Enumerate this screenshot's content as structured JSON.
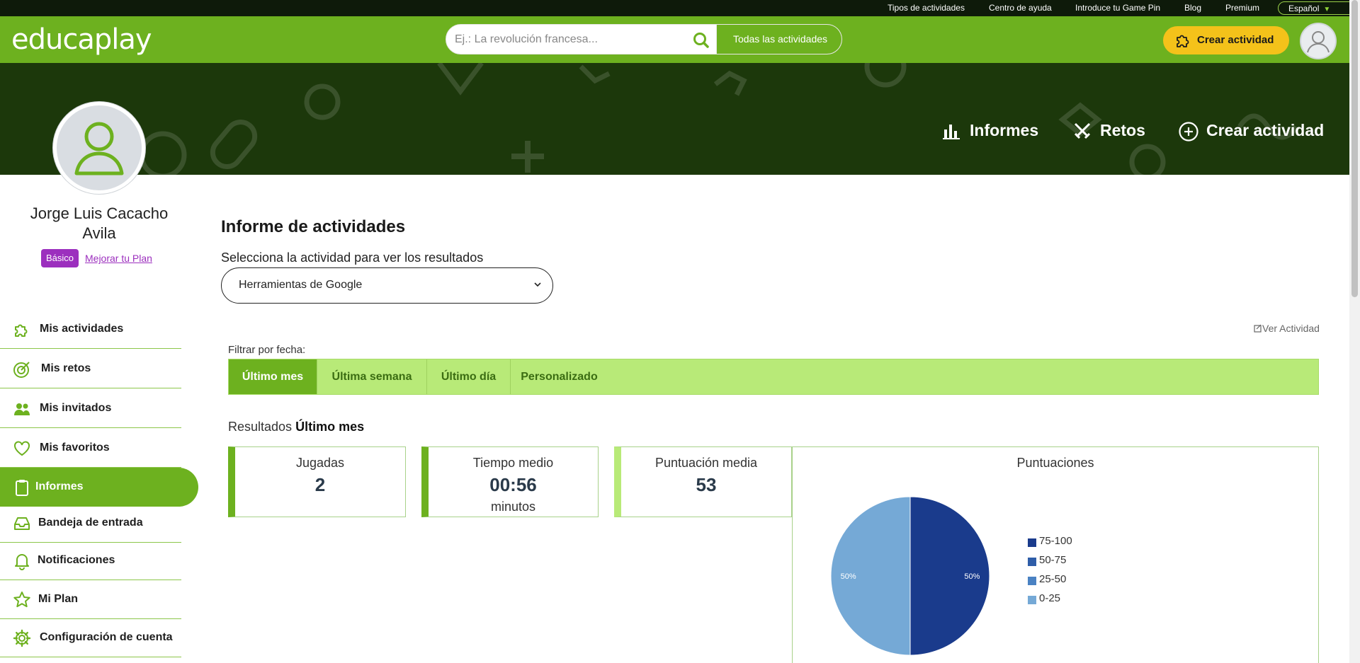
{
  "topbar": {
    "links": [
      "Tipos de actividades",
      "Centro de ayuda",
      "Introduce tu Game Pin",
      "Blog",
      "Premium"
    ],
    "language": "Español"
  },
  "header": {
    "logo": "educaplay",
    "search_placeholder": "Ej.: La revolución francesa...",
    "search_scope": "Todas las actividades",
    "create_label": "Crear actividad"
  },
  "banner_nav": {
    "reports": "Informes",
    "challenges": "Retos",
    "create": "Crear actividad"
  },
  "profile": {
    "name": "Jorge Luis Cacacho Avila",
    "plan": "Básico",
    "upgrade": "Mejorar tu Plan"
  },
  "sidebar": {
    "items": [
      {
        "label": "Mis actividades",
        "icon": "puzzle-icon"
      },
      {
        "label": "Mis retos",
        "icon": "target-icon"
      },
      {
        "label": "Mis invitados",
        "icon": "people-icon"
      },
      {
        "label": "Mis favoritos",
        "icon": "heart-icon"
      },
      {
        "label": "Informes",
        "icon": "clipboard-icon",
        "active": true
      },
      {
        "label": "Bandeja de entrada",
        "icon": "inbox-icon"
      },
      {
        "label": "Notificaciones",
        "icon": "bell-icon"
      },
      {
        "label": "Mi Plan",
        "icon": "star-icon"
      },
      {
        "label": "Configuración de cuenta",
        "icon": "gear-icon"
      }
    ]
  },
  "main": {
    "title": "Informe de actividades",
    "select_label": "Selecciona la actividad para ver los resultados",
    "selected_activity": "Herramientas de Google",
    "view_activity": "Ver Actividad",
    "filter_label": "Filtrar por fecha:",
    "filters": [
      "Último mes",
      "Última semana",
      "Último día",
      "Personalizado"
    ],
    "active_filter": "Último mes",
    "results_prefix": "Resultados",
    "results_period": "Último mes",
    "cards": {
      "plays": {
        "title": "Jugadas",
        "value": "2"
      },
      "avg_time": {
        "title": "Tiempo medio",
        "value": "00:56",
        "unit": "minutos"
      },
      "avg_score": {
        "title": "Puntuación media",
        "value": "53"
      }
    }
  },
  "chart_data": {
    "type": "pie",
    "title": "Puntuaciones",
    "categories": [
      "75-100",
      "50-75",
      "25-50",
      "0-25"
    ],
    "values": [
      50,
      0,
      0,
      50
    ],
    "data_labels": [
      "50%",
      "",
      "",
      "50%"
    ],
    "colors": [
      "#1a3b8c",
      "#2e5da8",
      "#4a82c3",
      "#75a9d6"
    ],
    "legend_position": "right"
  },
  "colors": {
    "brand_green": "#6db11f",
    "banner_dark": "#1c380b",
    "accent_yellow": "#f4c21a",
    "plan_purple": "#9c2fbe",
    "filter_light": "#b8ea78"
  }
}
